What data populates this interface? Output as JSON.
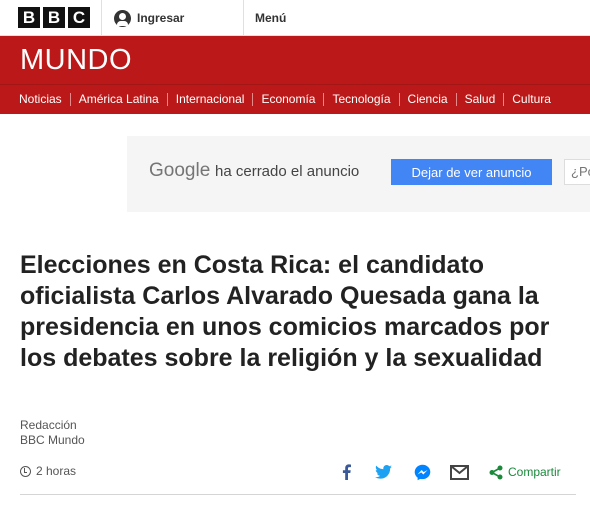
{
  "brand": {
    "letters": [
      "B",
      "B",
      "C"
    ]
  },
  "topbar": {
    "signin_label": "Ingresar",
    "menu_label": "Menú"
  },
  "section": {
    "title": "MUNDO"
  },
  "nav": {
    "items": [
      "Noticias",
      "América Latina",
      "Internacional",
      "Economía",
      "Tecnología",
      "Ciencia",
      "Salud",
      "Cultura"
    ]
  },
  "ad": {
    "google_label": "Google",
    "closed_text": "ha cerrado el anuncio",
    "stop_button": "Dejar de ver anuncio",
    "why_text": "¿Po"
  },
  "article": {
    "headline": "Elecciones en Costa Rica: el candidato oficialista Carlos Alvarado Quesada gana la presidencia en unos comicios marcados por los debates sobre la religión y la sexualidad",
    "byline_role": "Redacción",
    "byline_org": "BBC Mundo",
    "time": "2 horas",
    "share_label": "Compartir"
  },
  "colors": {
    "brand_red": "#bb1919",
    "ad_blue": "#4285f4",
    "facebook": "#3b5998",
    "twitter": "#1da1f2",
    "messenger": "#0084ff",
    "share_green": "#1a8a3a"
  },
  "icons": [
    "user-icon",
    "clock-icon",
    "facebook-icon",
    "twitter-icon",
    "messenger-icon",
    "email-icon",
    "share-icon"
  ]
}
